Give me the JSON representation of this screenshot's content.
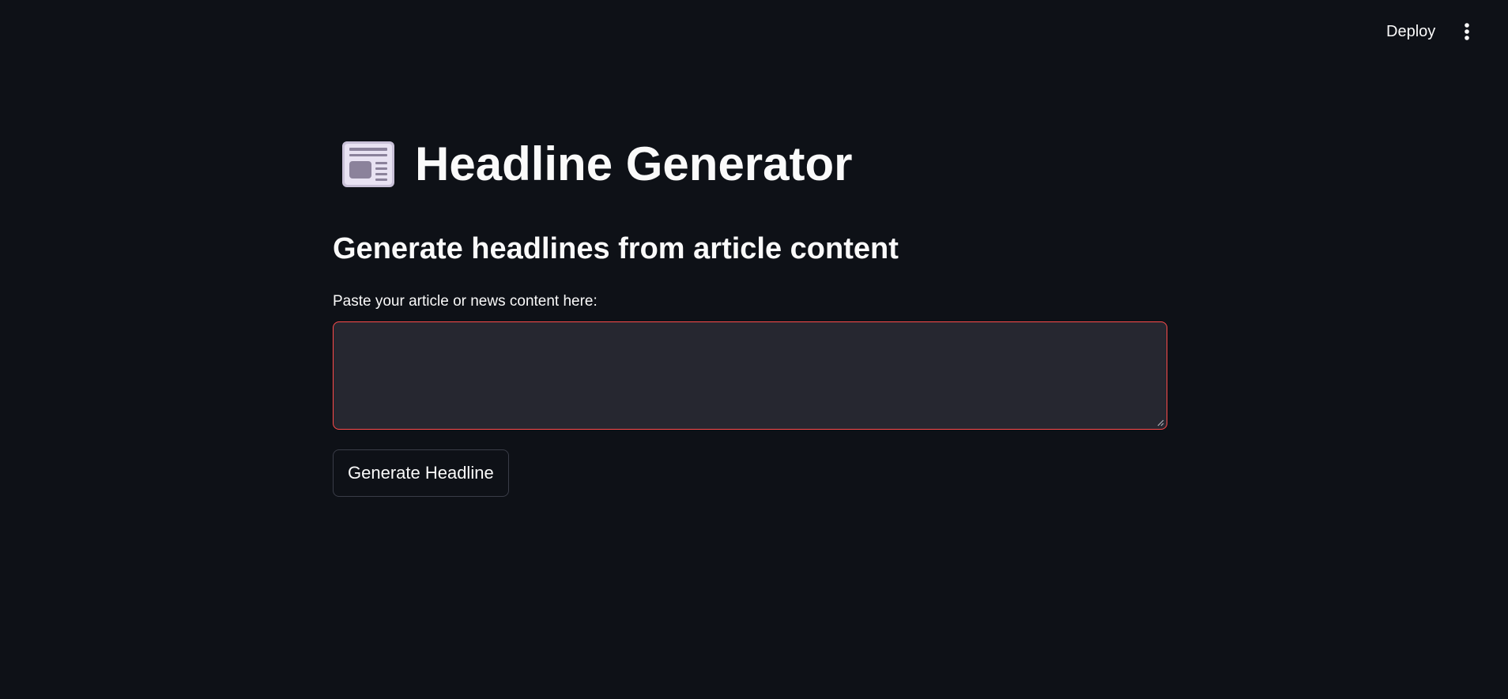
{
  "header": {
    "deploy_label": "Deploy",
    "menu_icon": "more-vertical-icon"
  },
  "main": {
    "title_icon": "newspaper-icon",
    "title": "Headline Generator",
    "subtitle": "Generate headlines from article content",
    "input": {
      "label": "Paste your article or news content here:",
      "value": "",
      "placeholder": ""
    },
    "generate_button_label": "Generate Headline"
  },
  "colors": {
    "background": "#0e1117",
    "input_background": "#262730",
    "input_border_focus": "#ff4b4b",
    "text": "#fafafa"
  }
}
